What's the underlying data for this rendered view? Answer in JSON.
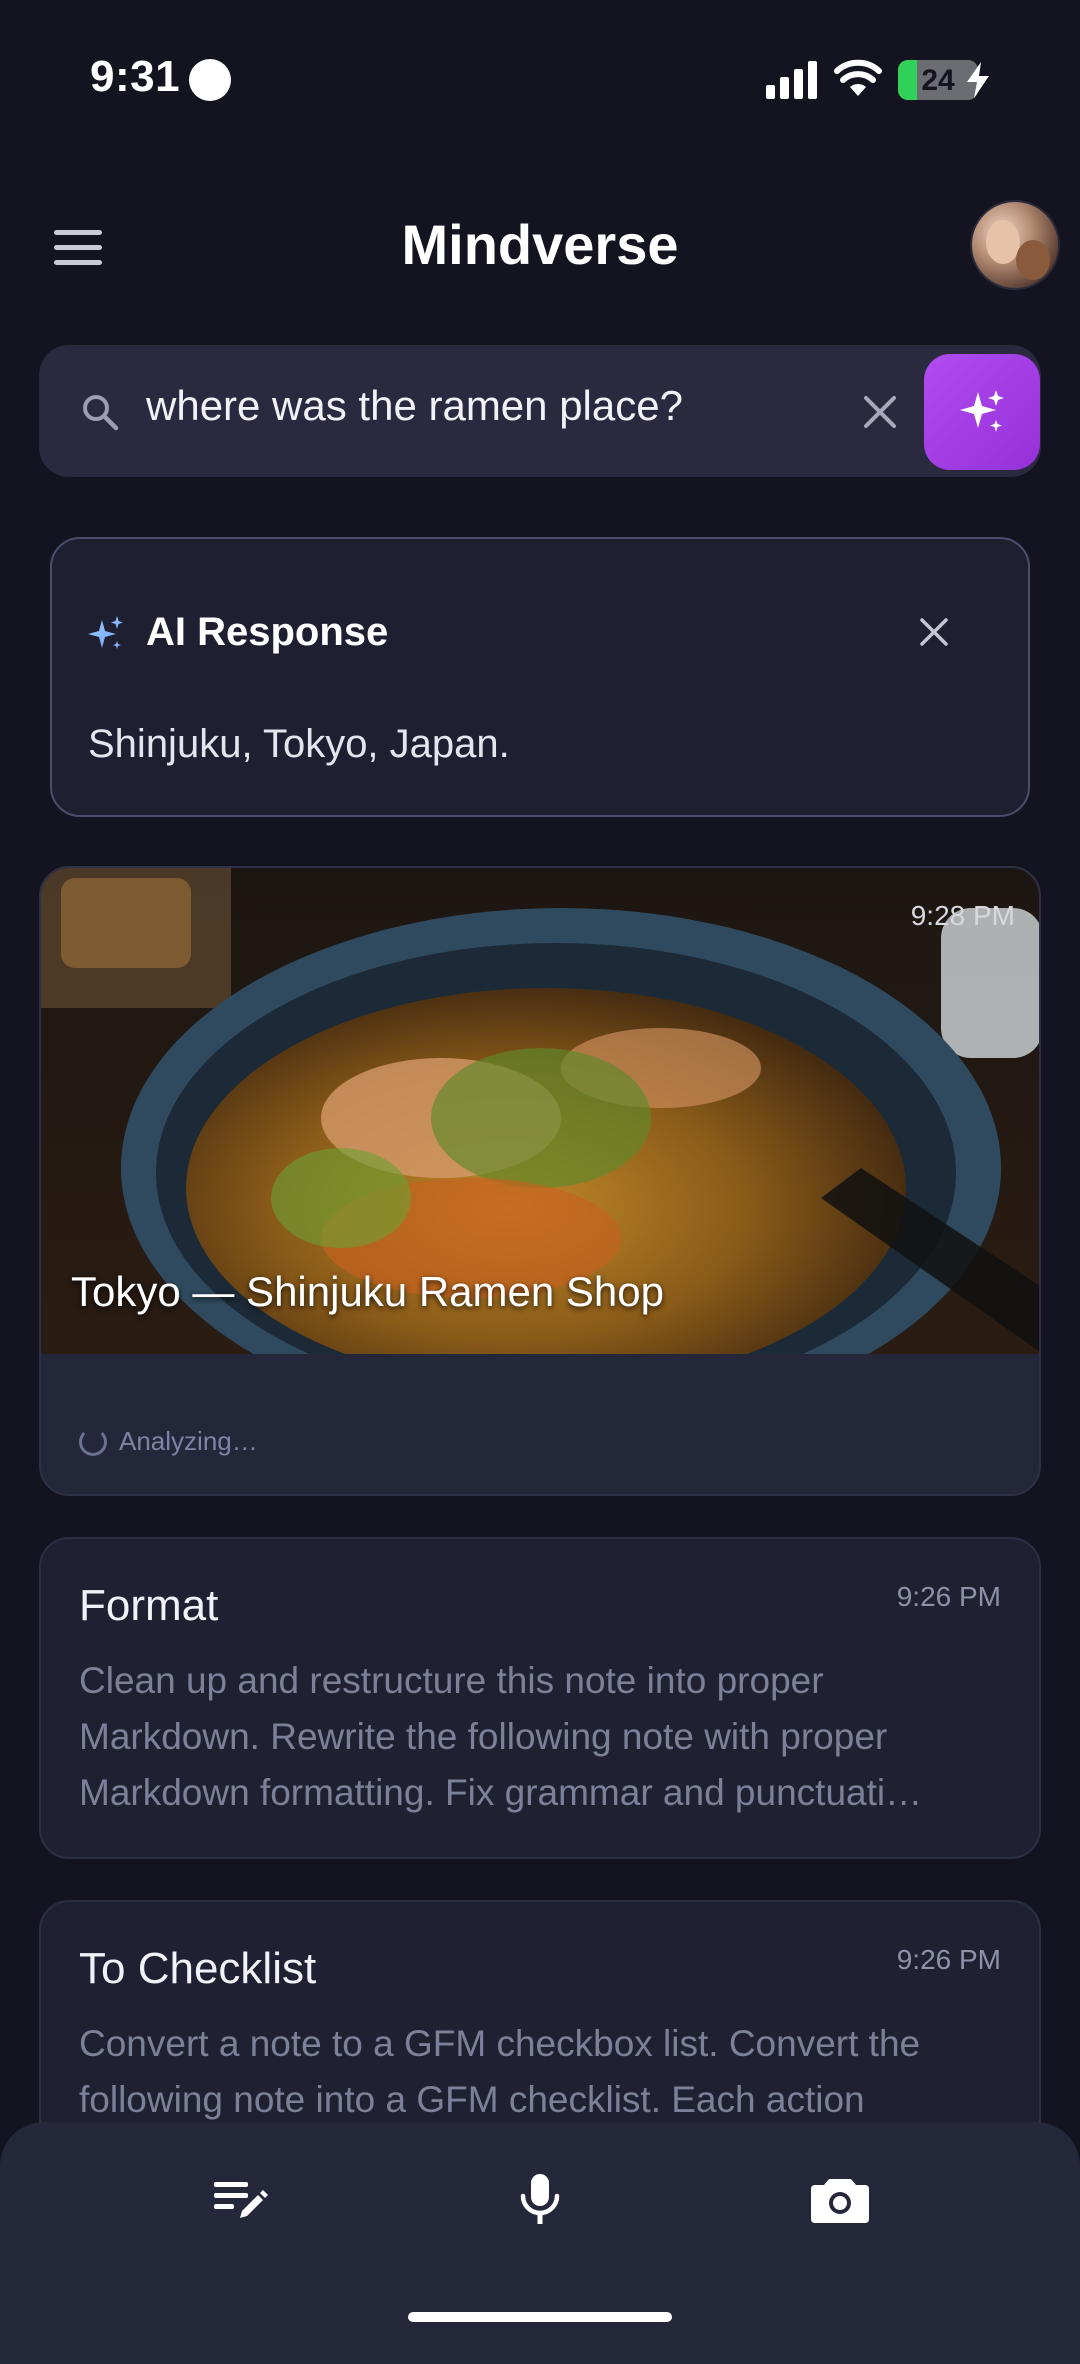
{
  "status_bar": {
    "time": "9:31",
    "battery": "24"
  },
  "header": {
    "title": "Mindverse",
    "menu_icon": "hamburger-menu-icon",
    "avatar_icon": "user-avatar"
  },
  "search": {
    "query": "where was the ramen place?",
    "icon": "search-icon",
    "clear_icon": "close-icon",
    "ai_button_icon": "sparkle-icon",
    "accent": "#a13fe4"
  },
  "ai_response": {
    "title": "AI Response",
    "text": "Shinjuku, Tokyo, Japan."
  },
  "photo_card": {
    "time": "9:28 PM",
    "caption": "Tokyo — Shinjuku Ramen Shop",
    "status": "Analyzing…"
  },
  "notes": [
    {
      "title": "Format",
      "time": "9:26 PM",
      "body": "Clean up and restructure this note into proper Markdown. Rewrite the following note with proper Markdown formatting. Fix grammar and punctuati…"
    },
    {
      "title": "To Checklist",
      "time": "9:26 PM",
      "body": "Convert a note to a GFM checkbox list. Convert the following note into a GFM checklist. Each action"
    }
  ],
  "bottom_bar": {
    "items": [
      "edit-note-icon",
      "microphone-icon",
      "camera-icon"
    ]
  }
}
